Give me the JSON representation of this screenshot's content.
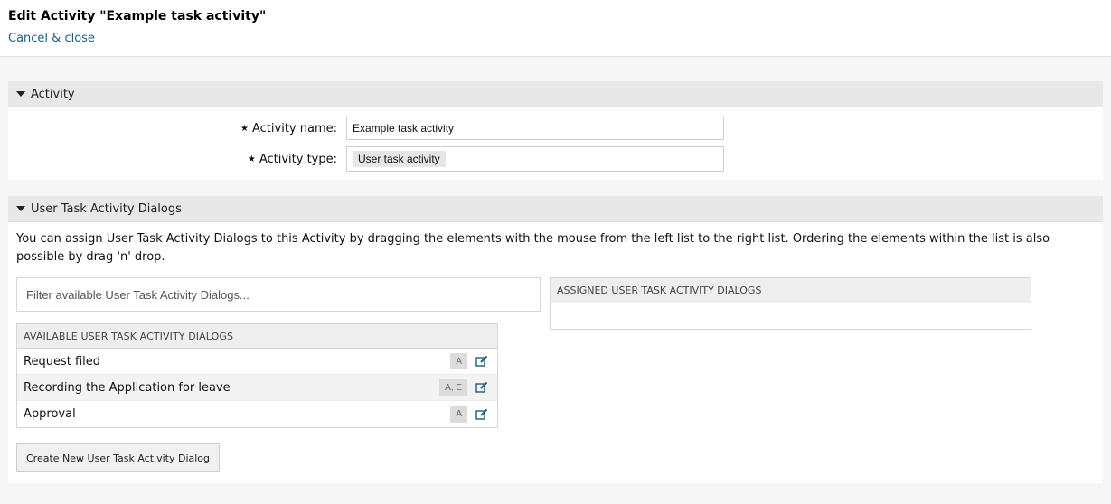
{
  "header": {
    "title": "Edit Activity \"Example task activity\"",
    "cancel_label": "Cancel & close"
  },
  "activity_section": {
    "title": "Activity",
    "name_label": "Activity name:",
    "name_value": "Example task activity",
    "type_label": "Activity type:",
    "type_value": "User task activity",
    "required_marker": "★"
  },
  "dialogs_section": {
    "title": "User Task Activity Dialogs",
    "description": "You can assign User Task Activity Dialogs to this Activity by dragging the elements with the mouse from the left list to the right list. Ordering the elements within the list is also possible by drag 'n' drop.",
    "filter_placeholder": "Filter available User Task Activity Dialogs...",
    "available_header": "AVAILABLE USER TASK ACTIVITY DIALOGS",
    "assigned_header": "ASSIGNED USER TASK ACTIVITY DIALOGS",
    "available_items": [
      {
        "label": "Request filed",
        "badge": "A"
      },
      {
        "label": "Recording the Application for leave",
        "badge": "A, E"
      },
      {
        "label": "Approval",
        "badge": "A"
      }
    ],
    "create_button": "Create New User Task Activity Dialog"
  },
  "colors": {
    "link": "#1f5e7e",
    "widget_header_bg": "#e8e8e8",
    "page_bg": "#f6f6f6"
  },
  "icons": {
    "collapse": "triangle-down-icon",
    "edit": "edit-icon",
    "required": "star-icon"
  }
}
